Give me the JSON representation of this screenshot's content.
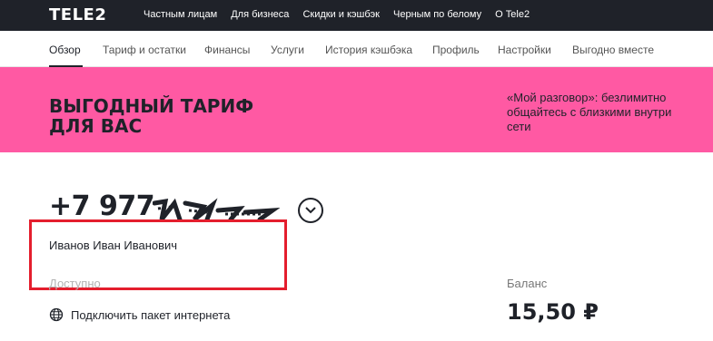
{
  "header": {
    "logo": "TELE2",
    "nav": [
      "Частным лицам",
      "Для бизнеса",
      "Скидки и кэшбэк",
      "Черным по белому",
      "О Tele2"
    ]
  },
  "tabs": [
    "Обзор",
    "Тариф и остатки",
    "Финансы",
    "Услуги",
    "История кэшбэка",
    "Профиль",
    "Настройки",
    "Выгодно вместе"
  ],
  "banner": {
    "title_line1": "ВЫГОДНЫЙ ТАРИФ",
    "title_line2": "ДЛЯ ВАС",
    "text_line1": "«Мой разговор»: безлимитно",
    "text_line2": "общайтесь с близкими внутри",
    "text_line3": "сети",
    "color": "#ff59a3"
  },
  "account": {
    "phone": "+7 977",
    "name": "Иванов Иван Иванович",
    "available_label": "Доступно",
    "internet_button": "Подключить пакет интернета",
    "balance_label": "Баланс",
    "balance_value": "15,50 ₽"
  },
  "icons": {
    "dropdown": "chevron-down-icon",
    "internet": "globe-icon"
  },
  "colors": {
    "header_bg": "#1f2229",
    "highlight_box": "#e41e2d"
  }
}
